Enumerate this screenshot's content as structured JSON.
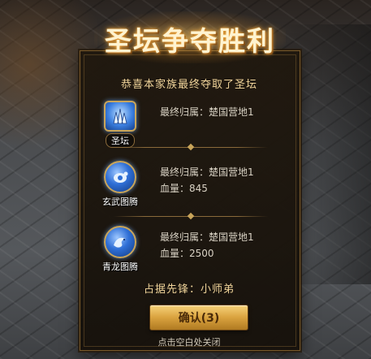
{
  "title": "圣坛争夺胜利",
  "subtitle": "恭喜本家族最终夺取了圣坛",
  "entries": [
    {
      "name": "圣坛",
      "owner": "最终归属：楚国营地1",
      "hp": "",
      "icon": "altar-icon"
    },
    {
      "name": "玄武图腾",
      "owner": "最终归属：楚国营地1",
      "hp": "血量：845",
      "icon": "tortoise-totem-icon"
    },
    {
      "name": "青龙图腾",
      "owner": "最终归属：楚国营地1",
      "hp": "血量：2500",
      "icon": "dragon-totem-icon"
    }
  ],
  "vanguard": "占据先锋：小师弟",
  "confirm_label": "确认(3)",
  "close_hint": "点击空白处关闭"
}
